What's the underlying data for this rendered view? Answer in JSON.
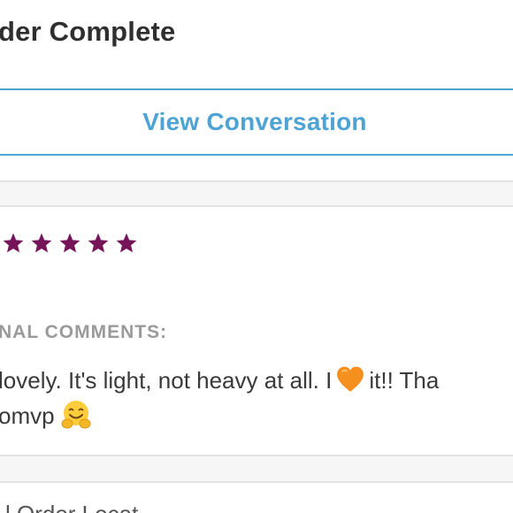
{
  "header": {
    "title": "der Complete"
  },
  "actions": {
    "view_conversation_label": "View Conversation"
  },
  "review": {
    "rating": 5,
    "rating_max": 5,
    "star_color": "#76145a"
  },
  "comments": {
    "section_label": "NAL COMMENTS:",
    "line1_before_emoji": "lovely. It's light, not heavy at all. I",
    "line1_after_emoji": "it!! Tha",
    "line2_text": "omvp",
    "emoji_1": "orange-heart-emoji",
    "emoji_2": "hugging-face-emoji"
  },
  "footer": {
    "partial_text": "l Order Locat"
  },
  "colors": {
    "link_blue": "#4da3d4",
    "title_text": "#2f2f2f",
    "label_gray": "#9a9a9a",
    "body_text": "#3a3a3a",
    "divider_band": "#f7f6f7"
  }
}
